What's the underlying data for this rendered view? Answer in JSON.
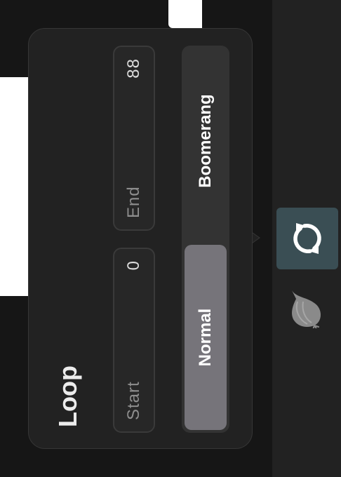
{
  "popover": {
    "title": "Loop",
    "start": {
      "label": "Start",
      "value": "0"
    },
    "end": {
      "label": "End",
      "value": "88"
    },
    "modes": [
      {
        "label": "Normal",
        "selected": true
      },
      {
        "label": "Boomerang",
        "selected": false
      }
    ]
  },
  "sidebar": {
    "tools": [
      {
        "icon": "loop-icon",
        "active": true
      },
      {
        "icon": "onion-skin-icon",
        "active": false
      }
    ]
  },
  "colors": {
    "panel": "#222222",
    "selected_segment": "#76747a",
    "active_tool": "#3a4e54",
    "text": "#ececec",
    "muted_text": "#8e8e8e"
  }
}
